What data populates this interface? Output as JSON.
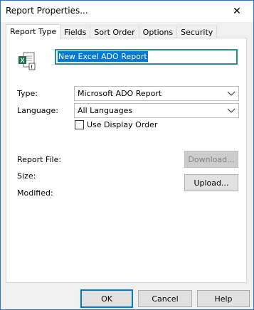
{
  "window": {
    "title": "Report Properties...",
    "close_glyph": "✕"
  },
  "tabs": [
    {
      "label": "Report Type",
      "active": true
    },
    {
      "label": "Fields",
      "active": false
    },
    {
      "label": "Sort Order",
      "active": false
    },
    {
      "label": "Options",
      "active": false
    },
    {
      "label": "Security",
      "active": false
    }
  ],
  "report": {
    "icon": "excel-report-icon",
    "name_value": "New Excel ADO Report"
  },
  "form": {
    "type_label": "Type:",
    "type_value": "Microsoft ADO Report",
    "language_label": "Language:",
    "language_value": "All Languages",
    "use_display_order_label": "Use Display Order",
    "use_display_order_checked": false,
    "report_file_label": "Report File:",
    "size_label": "Size:",
    "modified_label": "Modified:",
    "download_label": "Download...",
    "upload_label": "Upload..."
  },
  "buttons": {
    "ok": "OK",
    "cancel": "Cancel",
    "help": "Help"
  },
  "colors": {
    "accent": "#0078d7",
    "input_border": "#2e8b8f",
    "excel_green": "#1e7145"
  }
}
